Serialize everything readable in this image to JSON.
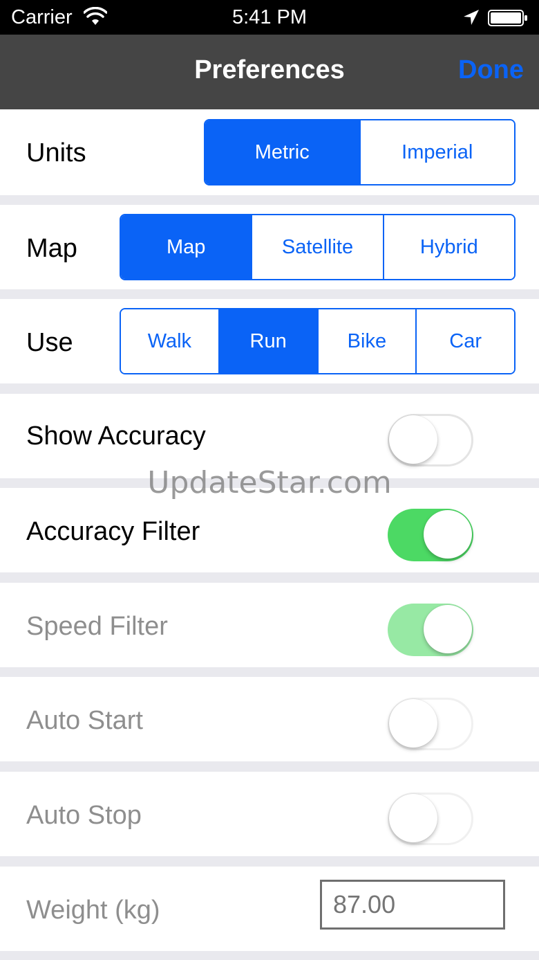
{
  "status_bar": {
    "carrier": "Carrier",
    "time": "5:41 PM",
    "icons": [
      "wifi-icon",
      "location-arrow-icon",
      "battery-icon"
    ]
  },
  "nav": {
    "title": "Preferences",
    "done_label": "Done"
  },
  "units": {
    "label": "Units",
    "options": [
      "Metric",
      "Imperial"
    ],
    "selected": "Metric"
  },
  "map": {
    "label": "Map",
    "options": [
      "Map",
      "Satellite",
      "Hybrid"
    ],
    "selected": "Map"
  },
  "use": {
    "label": "Use",
    "options": [
      "Walk",
      "Run",
      "Bike",
      "Car"
    ],
    "selected": "Run"
  },
  "toggles": {
    "show_accuracy": {
      "label": "Show Accuracy",
      "on": false,
      "enabled": true
    },
    "accuracy_filter": {
      "label": "Accuracy Filter",
      "on": true,
      "enabled": true
    },
    "speed_filter": {
      "label": "Speed Filter",
      "on": true,
      "enabled": false
    },
    "auto_start": {
      "label": "Auto Start",
      "on": false,
      "enabled": false
    },
    "auto_stop": {
      "label": "Auto Stop",
      "on": false,
      "enabled": false
    }
  },
  "weight": {
    "label": "Weight (kg)",
    "placeholder": "87.00"
  },
  "watermark": "UpdateStar.com",
  "colors": {
    "accent": "#0a63f6",
    "toggle_on": "#4cd964",
    "nav_bg": "#454545"
  }
}
